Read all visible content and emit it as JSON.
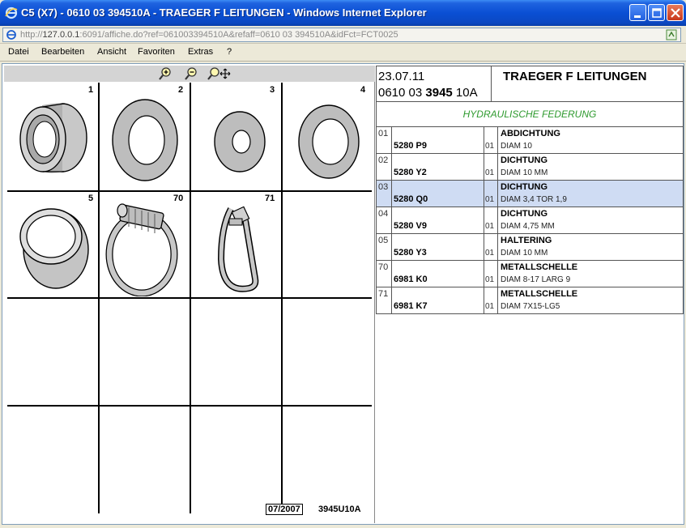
{
  "window": {
    "title": "C5 (X7) - 0610 03 394510A - TRAEGER F LEITUNGEN - Windows Internet Explorer"
  },
  "address": {
    "prefix": "http://",
    "host": "127.0.0.1",
    "rest": ":6091/affiche.do?ref=061003394510A&refaff=0610 03 394510A&idFct=FCT0025"
  },
  "menu": {
    "items": [
      "Datei",
      "Bearbeiten",
      "Ansicht",
      "Favoriten",
      "Extras",
      "?"
    ]
  },
  "diagram": {
    "cell_labels": [
      "1",
      "2",
      "3",
      "4",
      "5",
      "70",
      "71"
    ],
    "footer_date": "07/2007",
    "footer_code": "3945U10A"
  },
  "header": {
    "date": "23.07.11",
    "ref_prefix": "0610 03 ",
    "ref_bold": "3945",
    "ref_suffix": " 10A",
    "title": "TRAEGER F LEITUNGEN",
    "subtitle": "HYDRAULISCHE FEDERUNG"
  },
  "parts": [
    {
      "pos": "01",
      "ref": "5280 P9",
      "qty": "01",
      "name": "ABDICHTUNG",
      "detail": "DIAM 10",
      "selected": false
    },
    {
      "pos": "02",
      "ref": "5280 Y2",
      "qty": "01",
      "name": "DICHTUNG",
      "detail": "DIAM 10 MM",
      "selected": false
    },
    {
      "pos": "03",
      "ref": "5280 Q0",
      "qty": "01",
      "name": "DICHTUNG",
      "detail": "DIAM 3,4 TOR 1,9",
      "selected": true
    },
    {
      "pos": "04",
      "ref": "5280 V9",
      "qty": "01",
      "name": "DICHTUNG",
      "detail": "DIAM 4,75 MM",
      "selected": false
    },
    {
      "pos": "05",
      "ref": "5280 Y3",
      "qty": "01",
      "name": "HALTERING",
      "detail": "DIAM 10 MM",
      "selected": false
    },
    {
      "pos": "70",
      "ref": "6981 K0",
      "qty": "01",
      "name": "METALLSCHELLE",
      "detail": "DIAM 8-17 LARG 9",
      "selected": false
    },
    {
      "pos": "71",
      "ref": "6981 K7",
      "qty": "01",
      "name": "METALLSCHELLE",
      "detail": "DIAM 7X15-LG5",
      "selected": false
    }
  ],
  "colors": {
    "selected_row": "#cfdcf3",
    "subtitle": "#2e9a2e"
  }
}
